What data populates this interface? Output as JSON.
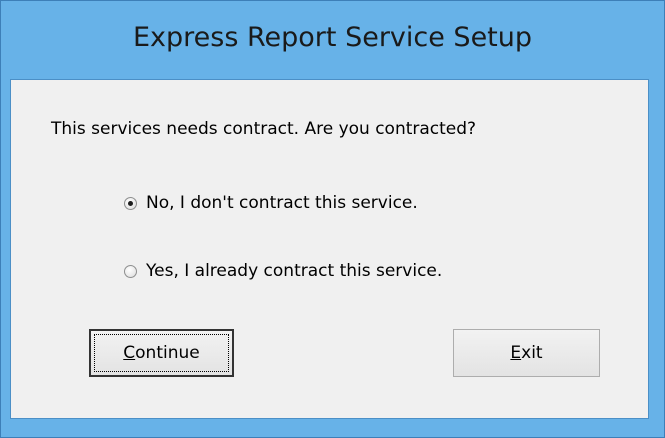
{
  "window": {
    "title": "Express Report Service Setup"
  },
  "dialog": {
    "question": "This services needs contract. Are you contracted?",
    "options": [
      {
        "label": "No, I don't contract this service.",
        "checked": true
      },
      {
        "label": "Yes, I already contract this service.",
        "checked": false
      }
    ],
    "buttons": {
      "continue": {
        "mnemonic": "C",
        "rest": "ontinue"
      },
      "exit": {
        "mnemonic": "E",
        "rest": "xit"
      }
    }
  },
  "colors": {
    "frame": "#67b2e8",
    "client_bg": "#f0f0f0"
  }
}
